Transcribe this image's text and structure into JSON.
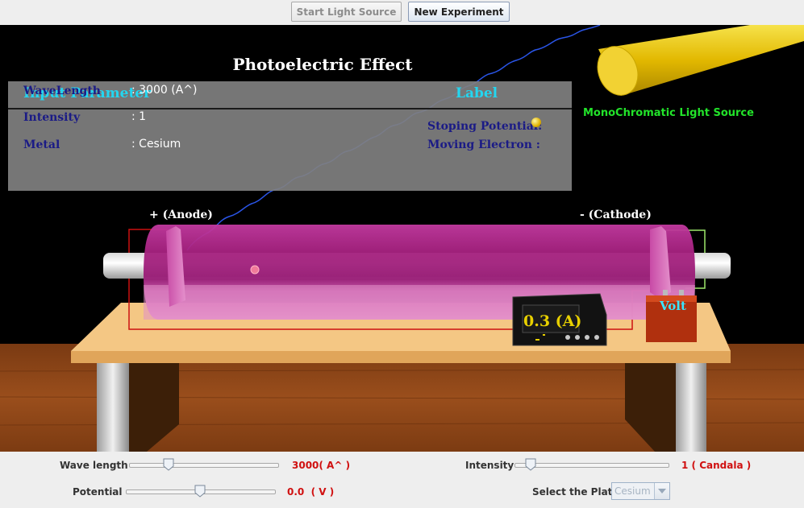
{
  "toolbar": {
    "start_label": "Start Light Source",
    "new_label": "New Experiment"
  },
  "scene": {
    "title": "Photoelectric Effect",
    "panel": {
      "input_header": "Input Parameter",
      "label_header": "Label",
      "rows": [
        {
          "key": "WaveLength",
          "value": ": 3000 (A^)"
        },
        {
          "key": "Intensity",
          "value": ": 1"
        },
        {
          "key": "Metal",
          "value": ": Cesium"
        }
      ],
      "stopping_potential_label": "Stoping Potential:",
      "moving_electron_label": "Moving Electron :"
    },
    "light_source_label": "MonoChromatic Light Source",
    "anode_label": "+ (Anode)",
    "cathode_label": "- (Cathode)",
    "ammeter_reading": "0.3 (A)",
    "voltmeter_label": "Volt"
  },
  "controls": {
    "wavelength": {
      "label": "Wave length",
      "value_text": "3000( A^ )",
      "level": 0.2
    },
    "intensity": {
      "label": "Intensity",
      "value_text": "1 ( Candala )",
      "level": 0.0
    },
    "potential": {
      "label": "Potential",
      "value_text": "0.0  ( V )",
      "level": 0.5
    },
    "plate": {
      "label": "Select the Plate",
      "selected": "Cesium"
    }
  },
  "colors": {
    "panel_header": "#23d6f0",
    "panel_key": "#1b1b86",
    "light_label": "#22e32a",
    "value_red": "#d01010",
    "tube": "#b0268e"
  },
  "icons": {
    "electron": "yellow-ball-icon",
    "dropdown": "chevron-down-icon"
  }
}
